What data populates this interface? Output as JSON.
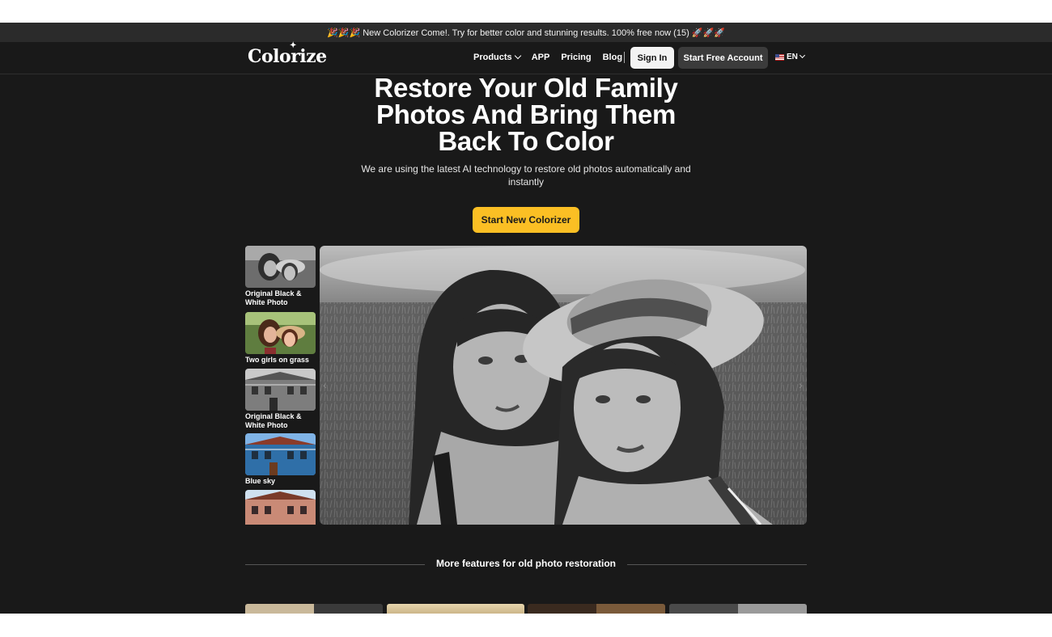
{
  "announcement": "🎉🎉🎉 New Colorizer Come!. Try for better color and stunning results. 100% free now (15) 🚀🚀🚀",
  "nav": {
    "logo": "Colorize",
    "links": [
      "Products",
      "APP",
      "Pricing",
      "Blog"
    ],
    "signin": "Sign In",
    "start_account": "Start Free Account",
    "lang": "EN"
  },
  "hero": {
    "title_lines": [
      "Restore Your Old Family",
      "Photos And Bring Them",
      "Back To Color"
    ],
    "subtitle_lines": [
      "We are using the latest AI technology to restore old photos automatically and",
      "instantly"
    ],
    "cta": "Start New Colorizer"
  },
  "gallery": {
    "labels": [
      "Original Black & White Photo",
      "Two girls on grass",
      "Original Black & White Photo",
      "Blue sky"
    ]
  },
  "features": {
    "title": "More features for old photo restoration"
  },
  "colors": {
    "background": "#191919",
    "accent": "#fbbf24",
    "announce_bg": "#2b2b2b"
  }
}
